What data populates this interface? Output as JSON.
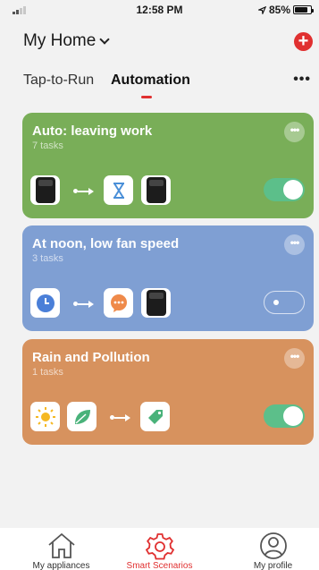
{
  "status_bar": {
    "time": "12:58 PM",
    "battery": "85%",
    "battery_level": 0.85
  },
  "header": {
    "title": "My Home",
    "add_icon": "plus-circle-icon",
    "accent": "#e03030"
  },
  "tabs": [
    {
      "label": "Tap-to-Run",
      "active": false
    },
    {
      "label": "Automation",
      "active": true
    }
  ],
  "more_icon": "more-horizontal-icon",
  "cards": [
    {
      "title": "Auto: leaving work",
      "subtitle": "7 tasks",
      "color": "#79ae58",
      "enabled": true,
      "conditions": [
        "dehumidifier-icon"
      ],
      "actions": [
        "hourglass-icon",
        "dehumidifier-icon"
      ]
    },
    {
      "title": "At noon, low fan speed",
      "subtitle": "3 tasks",
      "color": "#7f9fd3",
      "enabled": false,
      "conditions": [
        "clock-icon"
      ],
      "actions": [
        "message-icon",
        "dehumidifier-icon"
      ]
    },
    {
      "title": "Rain and Pollution",
      "subtitle": "1 tasks",
      "color": "#d7925e",
      "enabled": true,
      "conditions": [
        "sun-icon",
        "leaf-icon"
      ],
      "actions": [
        "tag-icon"
      ]
    }
  ],
  "bottom_nav": [
    {
      "label": "My appliances",
      "icon": "home-icon",
      "active": false
    },
    {
      "label": "Smart Scenarios",
      "icon": "gear-icon",
      "active": true
    },
    {
      "label": "My profile",
      "icon": "user-icon",
      "active": false
    }
  ]
}
